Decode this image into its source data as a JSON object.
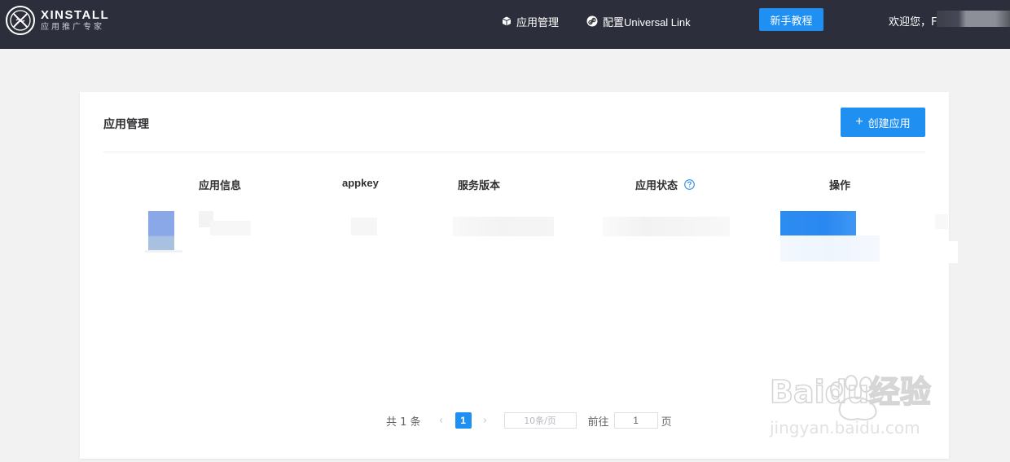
{
  "header": {
    "brand_name": "XINSTALL",
    "brand_tagline": "应用推广专家",
    "nav": [
      {
        "label": "应用管理",
        "icon": "cube-icon"
      },
      {
        "label": "配置Universal Link",
        "icon": "link-icon"
      }
    ],
    "tutorial_label": "新手教程",
    "welcome_text": "欢迎您，F"
  },
  "main": {
    "title": "应用管理",
    "create_label": "创建应用",
    "columns": [
      "应用信息",
      "appkey",
      "服务版本",
      "应用状态",
      "操作"
    ]
  },
  "pagination": {
    "total_text": "共 1 条",
    "current_page": "1",
    "page_size": "10条/页",
    "goto_label": "前往",
    "goto_value": "1",
    "page_unit": "页"
  },
  "watermark": {
    "brand": "Baidu经验",
    "url": "jingyan.baidu.com"
  },
  "colors": {
    "topbar": "#2c2e3b",
    "accent": "#1f8ff2",
    "background": "#f2f2f2"
  }
}
